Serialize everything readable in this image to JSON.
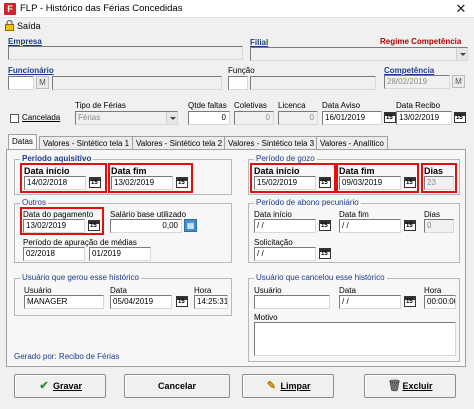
{
  "window": {
    "title": "FLP - Histórico das Férias Concedidas",
    "close": "✕"
  },
  "menu": {
    "saida": "Saída"
  },
  "header": {
    "empresa_label": "Empresa",
    "filial_label": "Filial",
    "regime_label": "Regime Competência",
    "funcionario_label": "Funcionário",
    "funcao_label": "Função",
    "competencia_label": "Competência",
    "competencia_value": "28/02/2019",
    "lookup_symbol": "M"
  },
  "row": {
    "cancelada_label": "Cancelada",
    "tipo_ferias_label": "Tipo de Férias",
    "tipo_ferias_value": "Férias",
    "qtde_faltas_label": "Qtde faltas",
    "qtde_faltas_value": "0",
    "coletivas_label": "Coletivas",
    "coletivas_value": "0",
    "licenca_label": "Licenca",
    "licenca_value": "0",
    "data_aviso_label": "Data Aviso",
    "data_aviso_value": "16/01/2019",
    "data_recibo_label": "Data Recibo",
    "data_recibo_value": "13/02/2019"
  },
  "tabs": [
    {
      "label": "Datas"
    },
    {
      "label": "Valores - Sintético tela 1"
    },
    {
      "label": "Valores - Sintético tela 2"
    },
    {
      "label": "Valores - Sintético tela 3"
    },
    {
      "label": "Valores - Analítico"
    }
  ],
  "aquisitivo": {
    "title": "Período aquisitivo",
    "inicio_label": "Data início",
    "inicio_value": "14/02/2018",
    "fim_label": "Data fim",
    "fim_value": "13/02/2019"
  },
  "gozo": {
    "title": "Período de gozo",
    "inicio_label": "Data início",
    "inicio_value": "15/02/2019",
    "fim_label": "Data fim",
    "fim_value": "09/03/2019",
    "dias_label": "Dias",
    "dias_value": "23"
  },
  "outros": {
    "title": "Outros",
    "pagamento_label": "Data do pagamento",
    "pagamento_value": "13/02/2019",
    "salario_label": "Salário base utilizado",
    "salario_value": "0,00",
    "apuracao_label": "Período de apuração de médias",
    "apuracao_inicio": "02/2018",
    "apuracao_fim": "01/2019"
  },
  "abono": {
    "title": "Período de abono pecuniário",
    "inicio_label": "Data início",
    "inicio_value": " / /",
    "fim_label": "Data fim",
    "fim_value": " / /",
    "dias_label": "Dias",
    "dias_value": "0",
    "solicitacao_label": "Solicitação",
    "solicitacao_value": " / /"
  },
  "gerou": {
    "title": "Usuário que gerou esse histórico",
    "usuario_label": "Usuário",
    "usuario_value": "MANAGER",
    "data_label": "Data",
    "data_value": "05/04/2019",
    "hora_label": "Hora",
    "hora_value": "14:25:31"
  },
  "cancelou": {
    "title": "Usuário que cancelou esse histórico",
    "usuario_label": "Usuário",
    "usuario_value": "",
    "data_label": "Data",
    "data_value": " / /",
    "hora_label": "Hora",
    "hora_value": "00:00:00",
    "motivo_label": "Motivo"
  },
  "gerado_por": "Gerado por: Recibo de Férias",
  "buttons": {
    "gravar": "Gravar",
    "cancelar": "Cancelar",
    "limpar": "Limpar",
    "excluir": "Excluir"
  },
  "colors": {
    "highlight": "#e01010",
    "regime": "#b00000",
    "title_icon": "#d3202a"
  }
}
